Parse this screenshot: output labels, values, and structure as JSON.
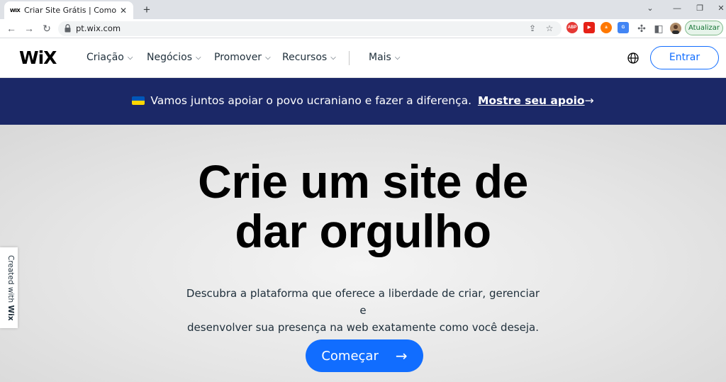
{
  "browser": {
    "tab": {
      "favicon_text": "WIX",
      "title": "Criar Site Grátis | Como Criar um",
      "close_icon": "close-icon"
    },
    "new_tab_glyph": "+",
    "window_controls": [
      "chevron-down-icon",
      "minimize-icon",
      "restore-icon",
      "close-icon"
    ],
    "url": "pt.wix.com",
    "extensions": [
      {
        "name": "abp-extension-icon",
        "label": "ABP",
        "color": "#e53935"
      },
      {
        "name": "youtube-extension-icon",
        "label": "▶",
        "color": "#e62117"
      },
      {
        "name": "avast-extension-icon",
        "label": "a",
        "color": "#ff7800"
      },
      {
        "name": "translate-extension-icon",
        "label": "G",
        "color": "#4285f4"
      }
    ],
    "update_label": "Atualizar"
  },
  "header": {
    "logo": "WiX",
    "nav": [
      {
        "label": "Criação"
      },
      {
        "label": "Negócios"
      },
      {
        "label": "Promover"
      },
      {
        "label": "Recursos"
      },
      {
        "label": "Mais"
      }
    ],
    "login_label": "Entrar"
  },
  "banner": {
    "text": "Vamos juntos apoiar o povo ucraniano e fazer a diferença.",
    "link": "Mostre seu apoio",
    "arrow": "→"
  },
  "hero": {
    "title_line1": "Crie um site de",
    "title_line2": "dar orgulho",
    "subtitle_line1": "Descubra a plataforma que oferece a liberdade de criar, gerenciar e",
    "subtitle_line2": "desenvolver sua presença na web exatamente como você deseja.",
    "cta_label": "Começar",
    "cta_arrow": "→"
  },
  "side_badge": {
    "prefix": "Created with ",
    "brand": "Wix"
  },
  "colors": {
    "accent": "#116dff",
    "banner_bg": "#1b2867",
    "ukraine_blue": "#0057b7",
    "ukraine_yellow": "#ffd700"
  }
}
